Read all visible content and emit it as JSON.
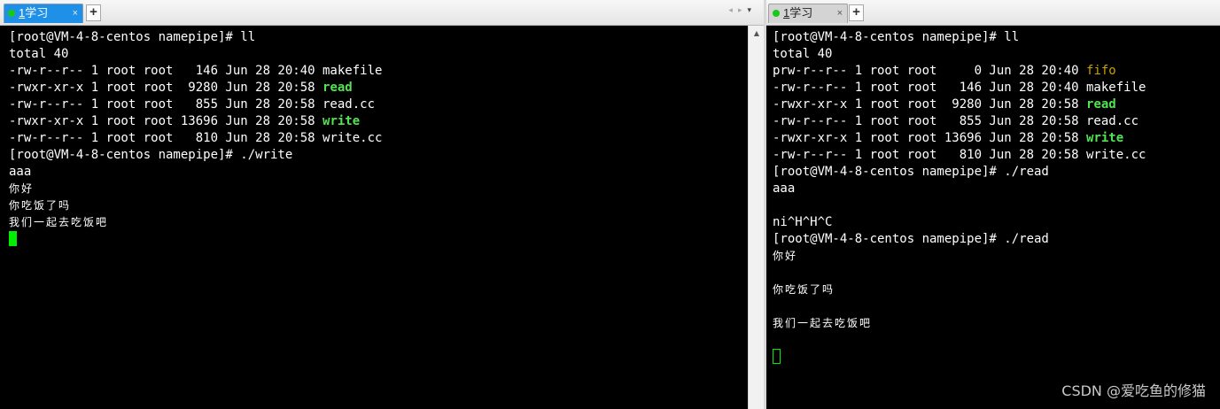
{
  "left": {
    "tab": {
      "index": "1",
      "label": "学习",
      "close": "×"
    },
    "add_tab": "+",
    "nav": {
      "prev": "◂",
      "next": "▸",
      "menu": "▾"
    },
    "scroll_up": "▲",
    "lines": [
      {
        "text": "[root@VM-4-8-centos namepipe]# ll"
      },
      {
        "text": "total 40"
      },
      {
        "text": "-rw-r--r-- 1 root root   146 Jun 28 20:40 makefile"
      },
      {
        "text": "-rwxr-xr-x 1 root root  9280 Jun 28 20:58 ",
        "name": "read",
        "kind": "exe"
      },
      {
        "text": "-rw-r--r-- 1 root root   855 Jun 28 20:58 read.cc"
      },
      {
        "text": "-rwxr-xr-x 1 root root 13696 Jun 28 20:58 ",
        "name": "write",
        "kind": "exe"
      },
      {
        "text": "-rw-r--r-- 1 root root   810 Jun 28 20:58 write.cc"
      },
      {
        "text": "[root@VM-4-8-centos namepipe]# ./write"
      },
      {
        "text": "aaa"
      },
      {
        "text": "你好",
        "cjk": true
      },
      {
        "text": "你吃饭了吗",
        "cjk": true
      },
      {
        "text": "我们一起去吃饭吧",
        "cjk": true
      }
    ]
  },
  "right": {
    "tab": {
      "index": "1",
      "label": "学习",
      "close": "×"
    },
    "add_tab": "+",
    "lines": [
      {
        "text": "[root@VM-4-8-centos namepipe]# ll"
      },
      {
        "text": "total 40"
      },
      {
        "text": "prw-r--r-- 1 root root     0 Jun 28 20:40 ",
        "name": "fifo",
        "kind": "fifo"
      },
      {
        "text": "-rw-r--r-- 1 root root   146 Jun 28 20:40 makefile"
      },
      {
        "text": "-rwxr-xr-x 1 root root  9280 Jun 28 20:58 ",
        "name": "read",
        "kind": "exe"
      },
      {
        "text": "-rw-r--r-- 1 root root   855 Jun 28 20:58 read.cc"
      },
      {
        "text": "-rwxr-xr-x 1 root root 13696 Jun 28 20:58 ",
        "name": "write",
        "kind": "exe"
      },
      {
        "text": "-rw-r--r-- 1 root root   810 Jun 28 20:58 write.cc"
      },
      {
        "text": "[root@VM-4-8-centos namepipe]# ./read"
      },
      {
        "text": "aaa"
      },
      {
        "text": ""
      },
      {
        "text": "ni^H^H^C"
      },
      {
        "text": "[root@VM-4-8-centos namepipe]# ./read"
      },
      {
        "text": "你好",
        "cjk": true
      },
      {
        "text": ""
      },
      {
        "text": "你吃饭了吗",
        "cjk": true
      },
      {
        "text": ""
      },
      {
        "text": "我们一起去吃饭吧",
        "cjk": true
      },
      {
        "text": ""
      }
    ]
  },
  "watermark": "CSDN @爱吃鱼的修猫",
  "colors": {
    "terminal_bg": "#000000",
    "terminal_fg": "#ffffff",
    "executable": "#52e352",
    "fifo": "#c8a200",
    "cursor": "#00ee00",
    "active_tab": "#1e90e8"
  }
}
